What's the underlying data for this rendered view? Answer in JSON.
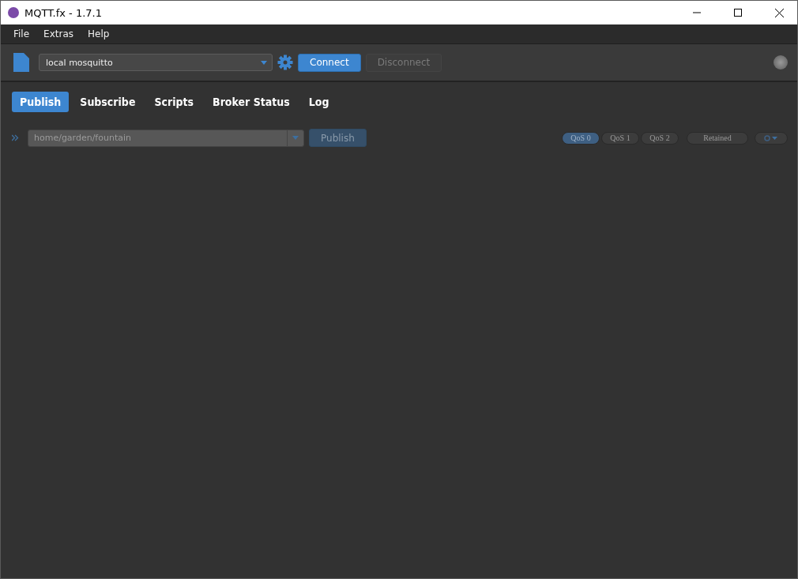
{
  "window": {
    "title": "MQTT.fx - 1.7.1"
  },
  "menu": [
    "File",
    "Extras",
    "Help"
  ],
  "toolbar": {
    "profile": "local mosquitto",
    "buttons": [
      {
        "label": "Connect",
        "disabled": false
      },
      {
        "label": "Disconnect",
        "disabled": true
      }
    ],
    "connected": false
  },
  "tabs": [
    {
      "label": "Publish",
      "selected": true
    },
    {
      "label": "Subscribe",
      "selected": false
    },
    {
      "label": "Scripts",
      "selected": false
    },
    {
      "label": "Broker Status",
      "selected": false
    },
    {
      "label": "Log",
      "selected": false
    }
  ],
  "publish_bar": {
    "topic": "home/garden/fountain",
    "button": {
      "label": "Publish",
      "disabled": true
    },
    "qos": [
      {
        "label": "QoS 0",
        "selected": true
      },
      {
        "label": "QoS 1",
        "selected": false
      },
      {
        "label": "QoS 2",
        "selected": false
      }
    ],
    "retained": {
      "label": "Retained",
      "selected": false
    }
  }
}
